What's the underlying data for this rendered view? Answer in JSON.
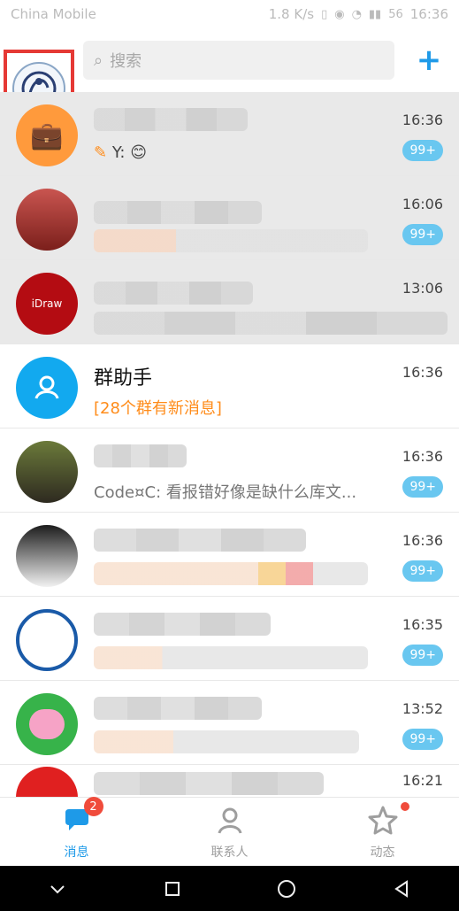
{
  "status_bar": {
    "carrier": "China Mobile",
    "speed": "1.8 K/s",
    "battery": "56",
    "time": "16:36"
  },
  "header": {
    "search_placeholder": "搜索"
  },
  "conversations": [
    {
      "id": "c1",
      "pinned": true,
      "time": "16:36",
      "badge": "99+",
      "sub_text": "Y:"
    },
    {
      "id": "c2",
      "pinned": true,
      "time": "16:06",
      "badge": "99+"
    },
    {
      "id": "c3",
      "pinned": true,
      "time": "13:06",
      "badge": ""
    },
    {
      "id": "c4",
      "pinned": false,
      "title": "群助手",
      "sub_text": "[28个群有新消息]",
      "time": "16:36",
      "badge": ""
    },
    {
      "id": "c5",
      "pinned": false,
      "time": "16:36",
      "badge": "99+",
      "sub_text": "Code¤C: 看报错好像是缺什么库文..."
    },
    {
      "id": "c6",
      "pinned": false,
      "time": "16:36",
      "badge": "99+"
    },
    {
      "id": "c7",
      "pinned": false,
      "time": "16:35",
      "badge": "99+"
    },
    {
      "id": "c8",
      "pinned": false,
      "time": "13:52",
      "badge": "99+"
    },
    {
      "id": "c9",
      "pinned": false,
      "time": "16:21",
      "badge": ""
    }
  ],
  "bottom_nav": [
    {
      "label": "消息",
      "active": true,
      "badge": "2",
      "icon": "chat-bubble-icon"
    },
    {
      "label": "联系人",
      "active": false,
      "badge": "",
      "icon": "contacts-icon"
    },
    {
      "label": "动态",
      "active": false,
      "badge": "dot",
      "icon": "star-icon"
    }
  ],
  "colors": {
    "accent": "#1e9ae8",
    "badge": "#69c7f0",
    "alert": "#f04b3b",
    "orange": "#ff8c1a"
  }
}
